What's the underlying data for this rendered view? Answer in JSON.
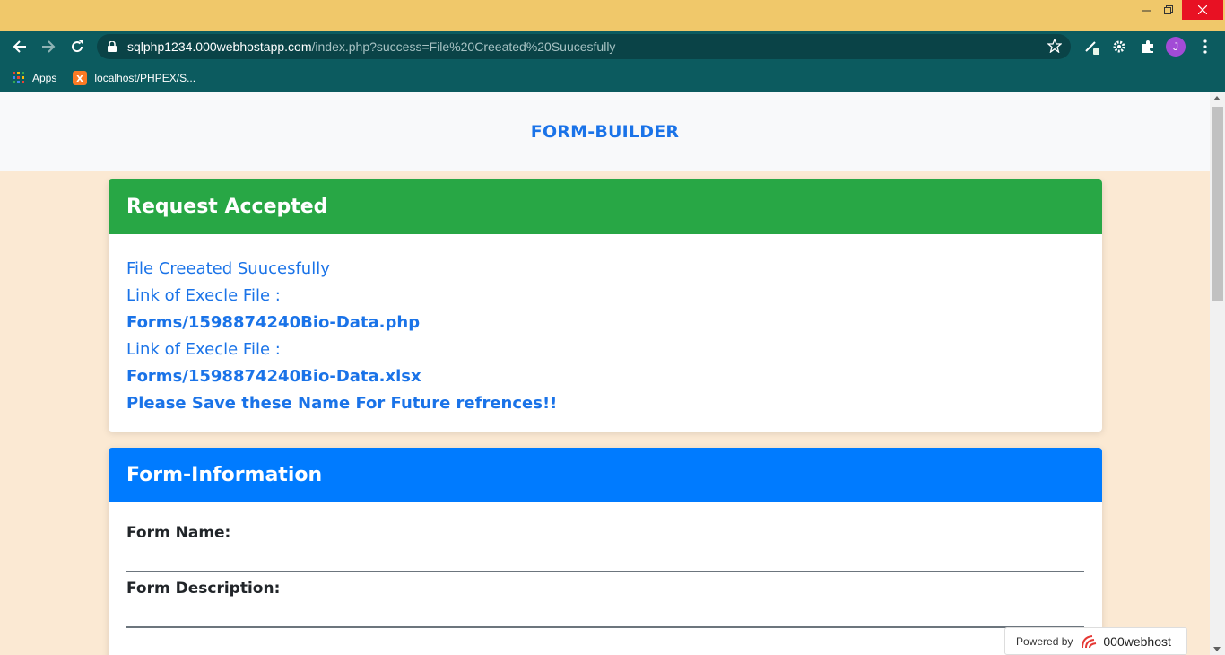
{
  "browser": {
    "url_host": "sqlphp1234.000webhostapp.com",
    "url_path": "/index.php?success=File%20Creeated%20Suucesfully",
    "profile_initial": "J",
    "bookmarks": [
      {
        "label": "Apps",
        "icon": "apps-grid-icon"
      },
      {
        "label": "localhost/PHPEX/S...",
        "icon": "xampp-icon"
      }
    ]
  },
  "page": {
    "brand": "FORM-BUILDER"
  },
  "accepted_card": {
    "title": "Request Accepted",
    "lines": [
      "File Creeated Suucesfully",
      "Link of Execle File :",
      "Forms/1598874240Bio-Data.php",
      "Link of Execle File :",
      "Forms/1598874240Bio-Data.xlsx",
      "Please Save these Name For Future refrences!!"
    ]
  },
  "info_card": {
    "title": "Form-Information",
    "form_name_label": "Form Name:",
    "form_description_label": "Form Description:"
  },
  "badge": {
    "powered_by": "Powered by",
    "brand": "000webhost"
  },
  "colors": {
    "success": "#28a745",
    "primary": "#007bff",
    "link": "#1a73e8",
    "page_bg": "#fbe9d3",
    "titlebar": "#f0c86a",
    "toolbar": "#0c5b5f"
  }
}
